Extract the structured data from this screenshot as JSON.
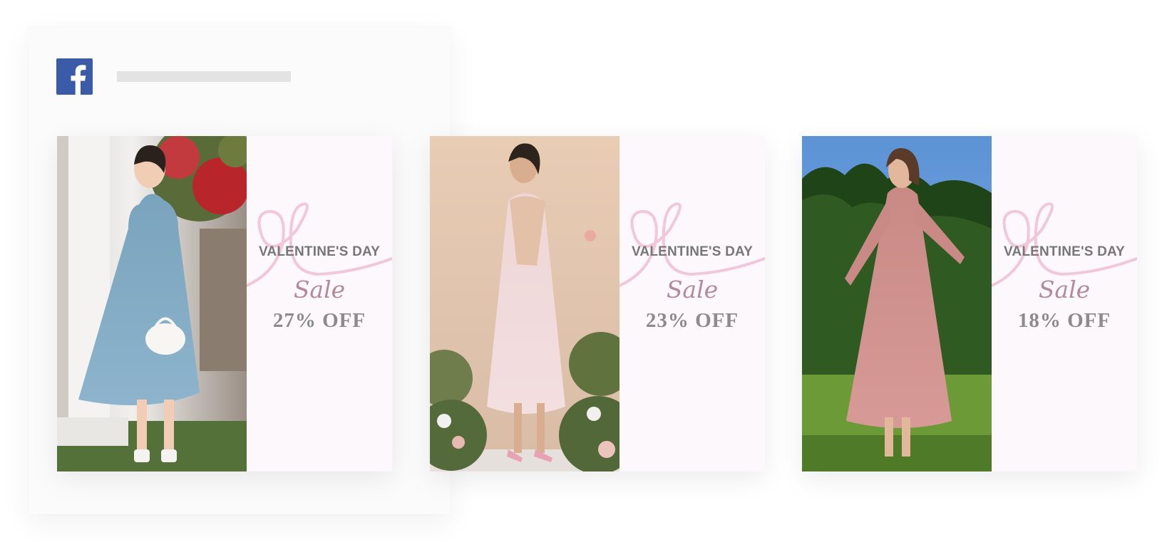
{
  "post": {
    "logo_icon": "facebook-icon",
    "brand_color": "#3b5ba9"
  },
  "slides": [
    {
      "title": "VALENTINE'S DAY",
      "script": "Sale",
      "discount": "27% OFF",
      "photo_icon": "blue-dress-model-photo"
    },
    {
      "title": "VALENTINE'S DAY",
      "script": "Sale",
      "discount": "23% OFF",
      "photo_icon": "pink-dress-model-photo"
    },
    {
      "title": "VALENTINE'S DAY",
      "script": "Sale",
      "discount": "18% OFF",
      "photo_icon": "rose-dress-model-photo"
    }
  ],
  "colors": {
    "promo_bg": "#fcf8fc",
    "heart": "#f2c8d6",
    "title": "#777777",
    "script": "#b38b97",
    "discount": "#8c8c8c"
  }
}
